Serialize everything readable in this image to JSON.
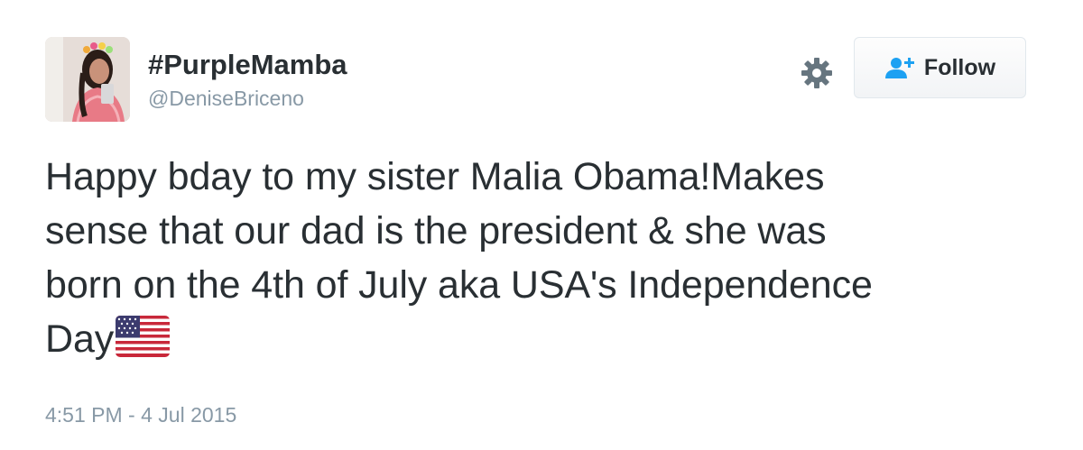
{
  "user": {
    "display_name": "#PurpleMamba",
    "screen_name": "@DeniseBriceno",
    "avatar_icon": "profile-photo"
  },
  "actions": {
    "settings_icon": "gear-icon",
    "follow_icon": "add-user-icon",
    "follow_label": "Follow"
  },
  "tweet": {
    "text_lines": [
      "Happy bday to my sister Malia Obama!Makes",
      "sense that our dad is the president & she was",
      "born on the 4th of July aka USA's Independence",
      "Day"
    ],
    "emoji": "us-flag-emoji",
    "timestamp": "4:51 PM - 4 Jul 2015"
  },
  "colors": {
    "text": "#292f33",
    "secondary": "#8899a6",
    "follow_icon": "#1da1f2",
    "gear": "#66757f"
  }
}
